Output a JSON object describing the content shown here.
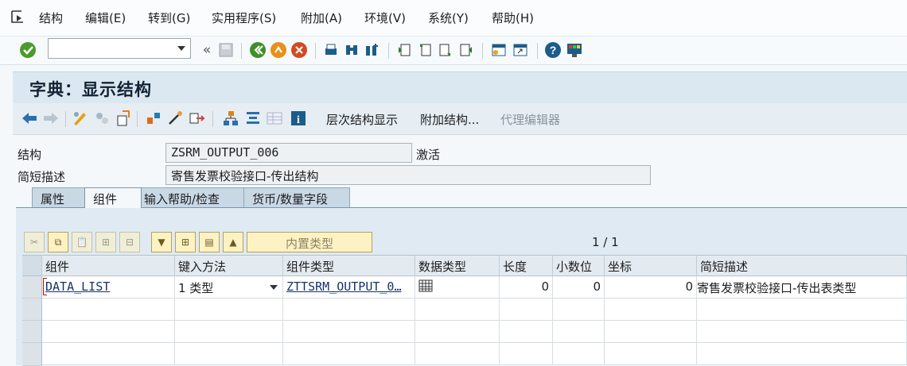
{
  "menu": {
    "items": [
      "结构",
      "编辑(E)",
      "转到(G)",
      "实用程序(S)",
      "附加(A)",
      "环境(V)",
      "系统(Y)",
      "帮助(H)"
    ]
  },
  "toolbar": {
    "command_value": "",
    "icons": [
      "check-icon",
      "dropdown-icon",
      "collapse-icon",
      "save-icon",
      "back-icon",
      "exit-icon",
      "cancel-icon",
      "print-icon",
      "find-icon",
      "find-next-icon",
      "first-page-icon",
      "prev-page-icon",
      "next-page-icon",
      "last-page-icon",
      "new-session-icon",
      "shortcut-icon",
      "help-icon",
      "customize-icon"
    ]
  },
  "title": "字典：显示结构",
  "app_toolbar": {
    "labels": [
      "层次结构显示",
      "附加结构...",
      "代理编辑器"
    ],
    "disabled_label": "代理编辑器"
  },
  "header": {
    "structure_label": "结构",
    "structure_value": "ZSRM_OUTPUT_006",
    "status": "激活",
    "desc_label": "简短描述",
    "desc_value": "寄售发票校验接口-传出结构"
  },
  "tabs": [
    "属性",
    "组件",
    "输入帮助/检查",
    "货币/数量字段"
  ],
  "active_tab": "组件",
  "table_toolbar": {
    "builtin_label": "内置类型",
    "pager": "1 / 1"
  },
  "table": {
    "columns": [
      "组件",
      "键入方法",
      "组件类型",
      "数据类型",
      "长度",
      "小数位",
      "坐标",
      "简短描述"
    ],
    "rows": [
      {
        "component": "DATA_LIST",
        "typing": "1 类型",
        "comp_type": "ZTTSRM_OUTPUT_0…",
        "data_type": "table-type-icon",
        "length": "0",
        "decimals": "0",
        "coord": "0",
        "desc": "寄售发票校验接口-传出表类型"
      }
    ]
  },
  "colors": {
    "title_bg": "#dce8f1",
    "panel_bg": "#dfeaf3",
    "button_bg": "#fdf2c4"
  }
}
